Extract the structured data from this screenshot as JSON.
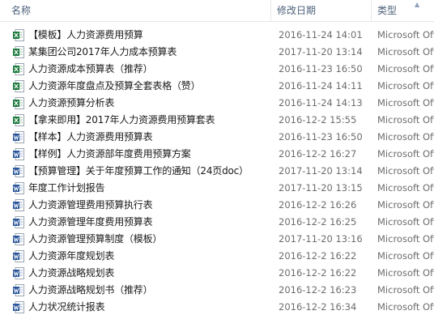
{
  "columns": {
    "name": "名称",
    "date": "修改日期",
    "type": "类型"
  },
  "colors": {
    "excel": "#1d7a3e",
    "word": "#2b579a"
  },
  "files": [
    {
      "name": "【模板】人力资源费用预算",
      "date": "2016-11-24 14:01",
      "type": "Microsoft Office Excel",
      "icon": "excel-file-icon"
    },
    {
      "name": "某集团公司2017年人力成本预算表",
      "date": "2017-11-20 13:14",
      "type": "Microsoft Office Excel",
      "icon": "excel-file-icon"
    },
    {
      "name": "人力资源成本预算表（推荐）",
      "date": "2016-11-23 16:50",
      "type": "Microsoft Office Excel",
      "icon": "excel-file-icon"
    },
    {
      "name": "人力资源年度盘点及预算全套表格（赞）",
      "date": "2016-11-24 14:11",
      "type": "Microsoft Office Excel",
      "icon": "excel-file-icon"
    },
    {
      "name": "人力资源预算分析表",
      "date": "2016-11-24 14:13",
      "type": "Microsoft Office Excel",
      "icon": "excel-file-icon"
    },
    {
      "name": "【拿来即用】2017年人力资源费用预算套表",
      "date": "2016-12-2 15:55",
      "type": "Microsoft Office Excel",
      "icon": "excel-file-icon"
    },
    {
      "name": "【样本】人力资源费用预算表",
      "date": "2016-11-23 16:50",
      "type": "Microsoft Office Word",
      "icon": "word-file-icon"
    },
    {
      "name": "【样例】人力资源部年度费用预算方案",
      "date": "2016-12-2 16:27",
      "type": "Microsoft Office Word",
      "icon": "word-file-icon"
    },
    {
      "name": "【预算管理】关于年度预算工作的通知（24页doc）",
      "date": "2017-11-20 13:14",
      "type": "Microsoft Office Word",
      "icon": "word-file-icon"
    },
    {
      "name": "年度工作计划报告",
      "date": "2017-11-20 13:15",
      "type": "Microsoft Office Word",
      "icon": "word-file-icon"
    },
    {
      "name": "人力资源管理费用预算执行表",
      "date": "2016-12-2 16:26",
      "type": "Microsoft Office Word",
      "icon": "word-file-icon"
    },
    {
      "name": "人力资源管理年度费用预算表",
      "date": "2016-12-2 16:25",
      "type": "Microsoft Office Word",
      "icon": "word-file-icon"
    },
    {
      "name": "人力资源管理预算制度（模板）",
      "date": "2017-11-20 13:16",
      "type": "Microsoft Office Word",
      "icon": "word-file-icon"
    },
    {
      "name": "人力资源年度规划表",
      "date": "2016-12-2 16:22",
      "type": "Microsoft Office Word",
      "icon": "word-file-icon"
    },
    {
      "name": "人力资源战略规划表",
      "date": "2016-12-2 16:22",
      "type": "Microsoft Office Word",
      "icon": "word-file-icon"
    },
    {
      "name": "人力资源战略规划书（推荐）",
      "date": "2016-12-2 16:23",
      "type": "Microsoft Office Word",
      "icon": "word-file-icon"
    },
    {
      "name": "人力状况统计报表",
      "date": "2016-12-2 16:34",
      "type": "Microsoft Office Word",
      "icon": "word-file-icon"
    }
  ]
}
